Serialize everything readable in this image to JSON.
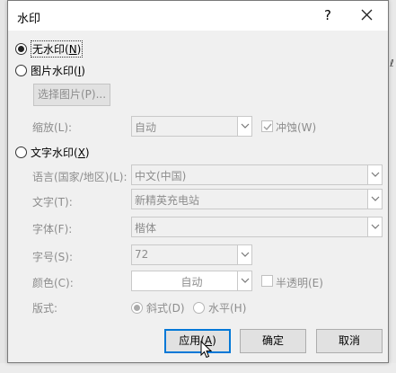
{
  "dialog": {
    "title": "水印",
    "help_label": "?",
    "close_icon": "close-icon"
  },
  "options": {
    "no_watermark": {
      "prefix": "无水印(",
      "key": "N",
      "suffix": ")",
      "selected": true
    },
    "picture_watermark": {
      "prefix": "图片水印(",
      "key": "I",
      "suffix": ")",
      "selected": false
    },
    "text_watermark": {
      "prefix": "文字水印(",
      "key": "X",
      "suffix": ")",
      "selected": false
    }
  },
  "picture": {
    "select_button": "选择图片(P)...",
    "scale_label": "缩放(L):",
    "scale_value": "自动",
    "washout_label": "冲蚀(W)",
    "washout_checked": true
  },
  "text": {
    "language_label": "语言(国家/地区)(L):",
    "language_value": "中文(中国)",
    "text_label": "文字(T):",
    "text_value": "新精英充电站",
    "font_label": "字体(F):",
    "font_value": "楷体",
    "size_label": "字号(S):",
    "size_value": "72",
    "color_label": "颜色(C):",
    "color_value": "自动",
    "semitransparent_label": "半透明(E)",
    "semitransparent_checked": false,
    "layout_label": "版式:",
    "layout_diagonal": "斜式(D)",
    "layout_horizontal": "水平(H)",
    "layout_selected": "diagonal"
  },
  "buttons": {
    "apply": {
      "prefix": "应用(",
      "key": "A",
      "suffix": ")"
    },
    "ok": "确定",
    "cancel": "取消"
  },
  "background": {
    "right_glyph": "ℓ"
  }
}
